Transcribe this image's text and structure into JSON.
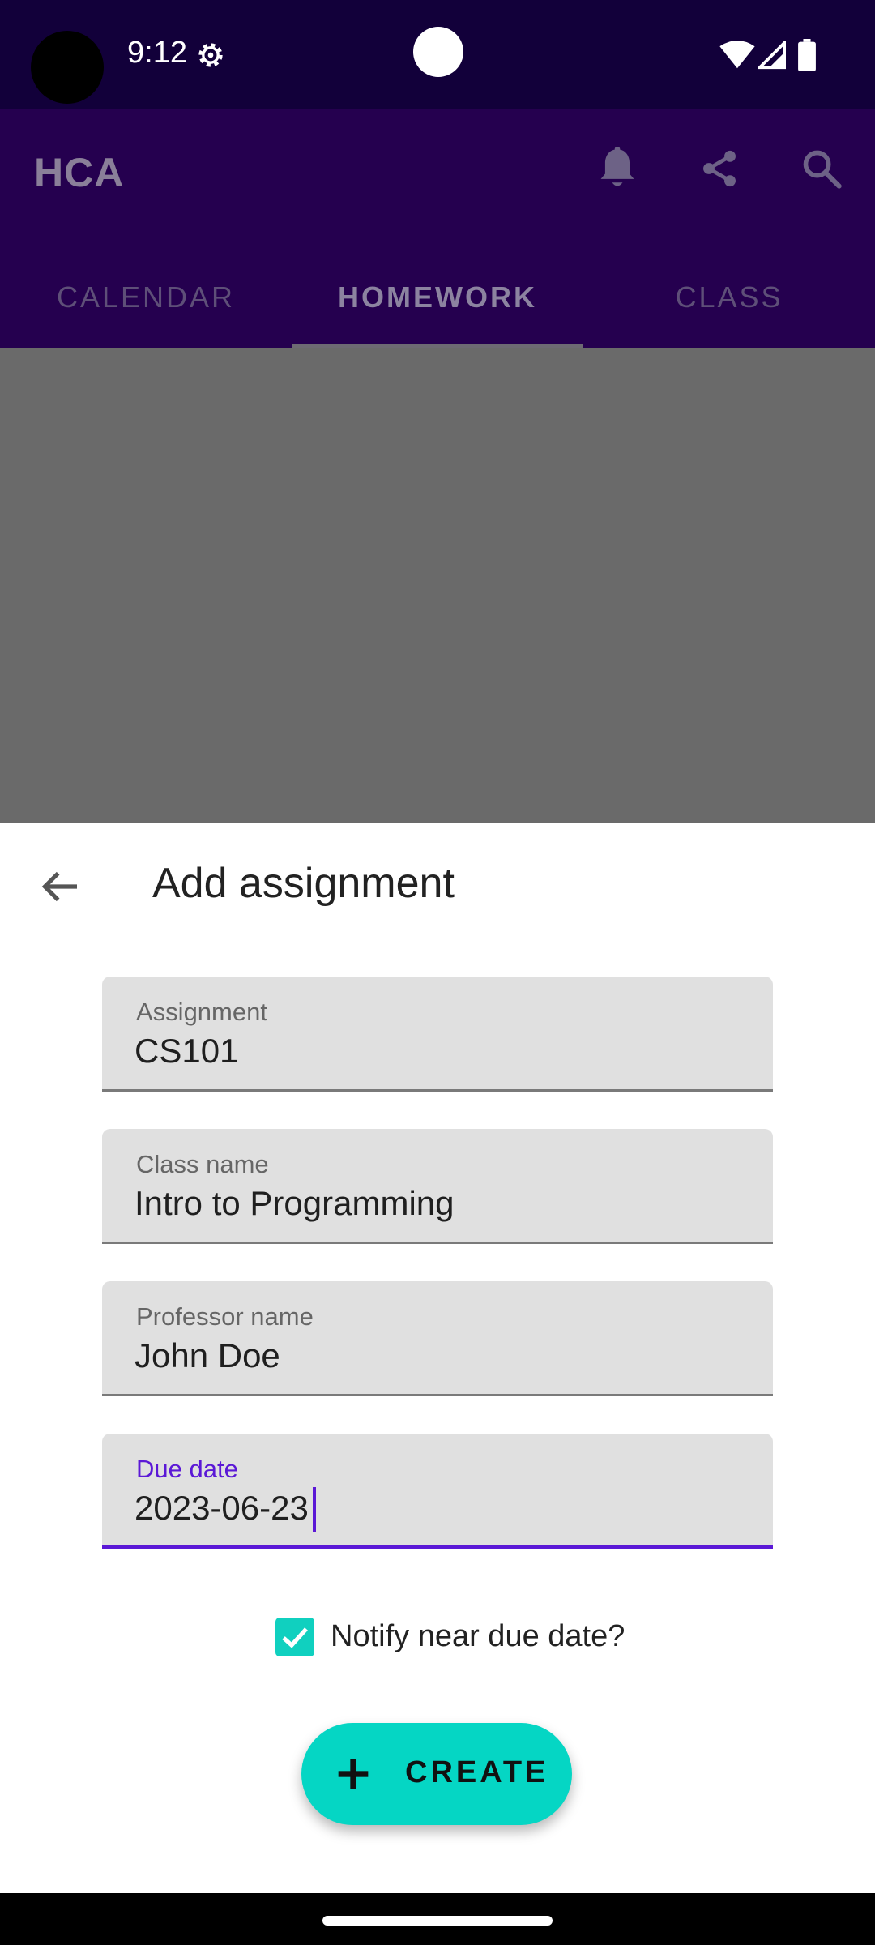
{
  "status_bar": {
    "time": "9:12"
  },
  "app_bar": {
    "title": "HCA",
    "tabs": [
      {
        "label": "CALENDAR"
      },
      {
        "label": "HOMEWORK"
      },
      {
        "label": "CLASS"
      }
    ],
    "active_tab": "HOMEWORK"
  },
  "sheet": {
    "title": "Add assignment",
    "fields": [
      {
        "label": "Assignment",
        "value": "CS101"
      },
      {
        "label": "Class name",
        "value": "Intro to Programming"
      },
      {
        "label": "Professor name",
        "value": "John Doe"
      },
      {
        "label": "Due date",
        "value": "2023-06-23"
      }
    ],
    "notify_label": "Notify near due date?",
    "notify_checked": true,
    "create_label": "CREATE"
  },
  "colors": {
    "status_bar": "#12003a",
    "app_bar": "#25004f",
    "accent": "#5b18d6",
    "button": "#05d6c4",
    "checkbox": "#10d0bf"
  },
  "icons": [
    "settings-icon",
    "wifi-icon",
    "signal-icon",
    "battery-icon",
    "bell-icon",
    "share-icon",
    "search-icon",
    "back-arrow-icon",
    "check-icon",
    "plus-icon"
  ]
}
